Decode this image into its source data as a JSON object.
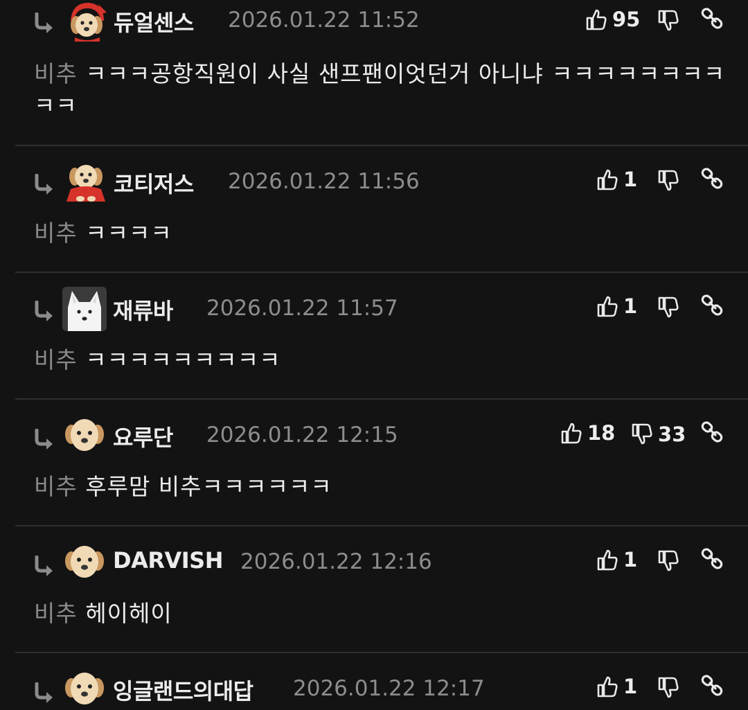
{
  "tag_label": "비추",
  "comments": [
    {
      "nickname": "듀얼센스",
      "datetime": "2026.01.22 11:52",
      "likes": "95",
      "dislikes": "",
      "text": "ㅋㅋㅋ공항직원이 사실 샌프팬이엇던거 아니냐 ㅋㅋㅋㅋㅋㅋㅋㅋㅋㅋ",
      "avatar_icon": "puppy-red-hood-avatar"
    },
    {
      "nickname": "코티저스",
      "datetime": "2026.01.22 11:56",
      "likes": "1",
      "dislikes": "",
      "text": "ㅋㅋㅋㅋ",
      "avatar_icon": "puppy-red-cape-avatar"
    },
    {
      "nickname": "재류바",
      "datetime": "2026.01.22 11:57",
      "likes": "1",
      "dislikes": "",
      "text": "ㅋㅋㅋㅋㅋㅋㅋㅋㅋ",
      "avatar_icon": "white-fox-avatar"
    },
    {
      "nickname": "요루단",
      "datetime": "2026.01.22 12:15",
      "likes": "18",
      "dislikes": "33",
      "text": "후루맘 비추ㅋㅋㅋㅋㅋㅋ",
      "avatar_icon": "puppy-avatar"
    },
    {
      "nickname": "DARVISH",
      "datetime": "2026.01.22 12:16",
      "likes": "1",
      "dislikes": "",
      "text": "헤이헤이",
      "avatar_icon": "puppy-avatar"
    },
    {
      "nickname": "잉글랜드의대답",
      "datetime": "2026.01.22 12:17",
      "likes": "1",
      "dislikes": "",
      "text": "",
      "avatar_icon": "puppy-avatar"
    }
  ],
  "colors": {
    "background": "#131313",
    "divider": "#2f2f2f",
    "tag": "#8a8a8a",
    "date": "#8d8d8d",
    "text": "#ececec"
  }
}
